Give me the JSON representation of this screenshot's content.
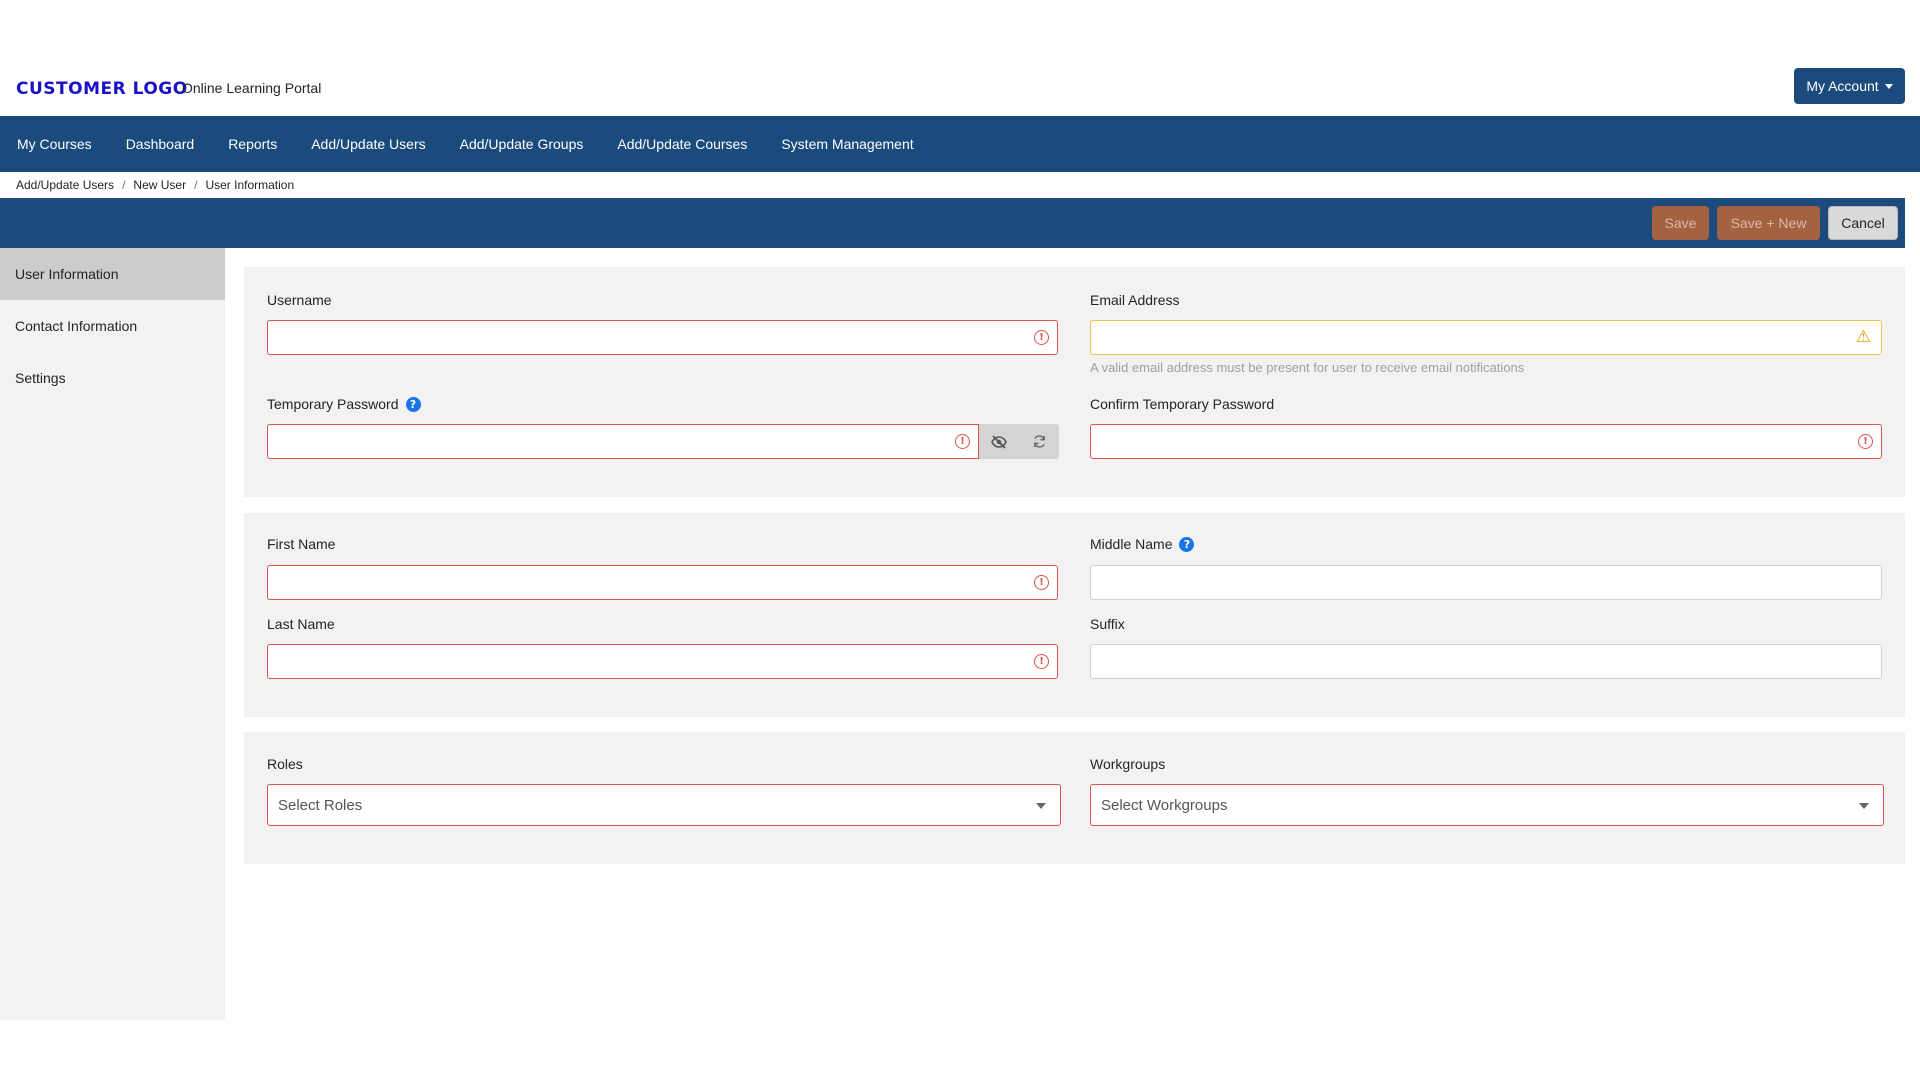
{
  "header": {
    "logo": "CUSTOMER LOGO",
    "portal_name": "Online Learning Portal",
    "account_button": "My Account"
  },
  "nav": {
    "items": [
      {
        "label": "My Courses"
      },
      {
        "label": "Dashboard"
      },
      {
        "label": "Reports"
      },
      {
        "label": "Add/Update Users"
      },
      {
        "label": "Add/Update Groups"
      },
      {
        "label": "Add/Update Courses"
      },
      {
        "label": "System Management"
      }
    ]
  },
  "breadcrumb": [
    "Add/Update Users",
    "New User",
    "User Information"
  ],
  "actions": {
    "save": "Save",
    "save_new": "Save + New",
    "cancel": "Cancel"
  },
  "sidebar": {
    "items": [
      {
        "label": "User Information",
        "active": true
      },
      {
        "label": "Contact Information",
        "active": false
      },
      {
        "label": "Settings",
        "active": false
      }
    ]
  },
  "form": {
    "username": {
      "label": "Username",
      "value": ""
    },
    "email": {
      "label": "Email Address",
      "value": "",
      "hint": "A valid email address must be present for user to receive email notifications"
    },
    "temp_password": {
      "label": "Temporary Password",
      "value": ""
    },
    "confirm_password": {
      "label": "Confirm Temporary Password",
      "value": ""
    },
    "first_name": {
      "label": "First Name",
      "value": ""
    },
    "middle_name": {
      "label": "Middle Name",
      "value": ""
    },
    "last_name": {
      "label": "Last Name",
      "value": ""
    },
    "suffix": {
      "label": "Suffix",
      "value": ""
    },
    "roles": {
      "label": "Roles",
      "placeholder": "Select Roles"
    },
    "workgroups": {
      "label": "Workgroups",
      "placeholder": "Select Workgroups"
    }
  },
  "colors": {
    "brand": "#1b4a7c",
    "logo": "#1a10c9",
    "error": "#d9534f",
    "warning": "#f0c24b",
    "save_button": "#a56240"
  },
  "icons": {
    "required": "exclamation-circle-icon",
    "warning": "warning-triangle-icon",
    "help": "question-circle-icon",
    "visibility": "eye-slash-icon",
    "generate": "refresh-icon",
    "dropdown": "caret-down-icon"
  }
}
